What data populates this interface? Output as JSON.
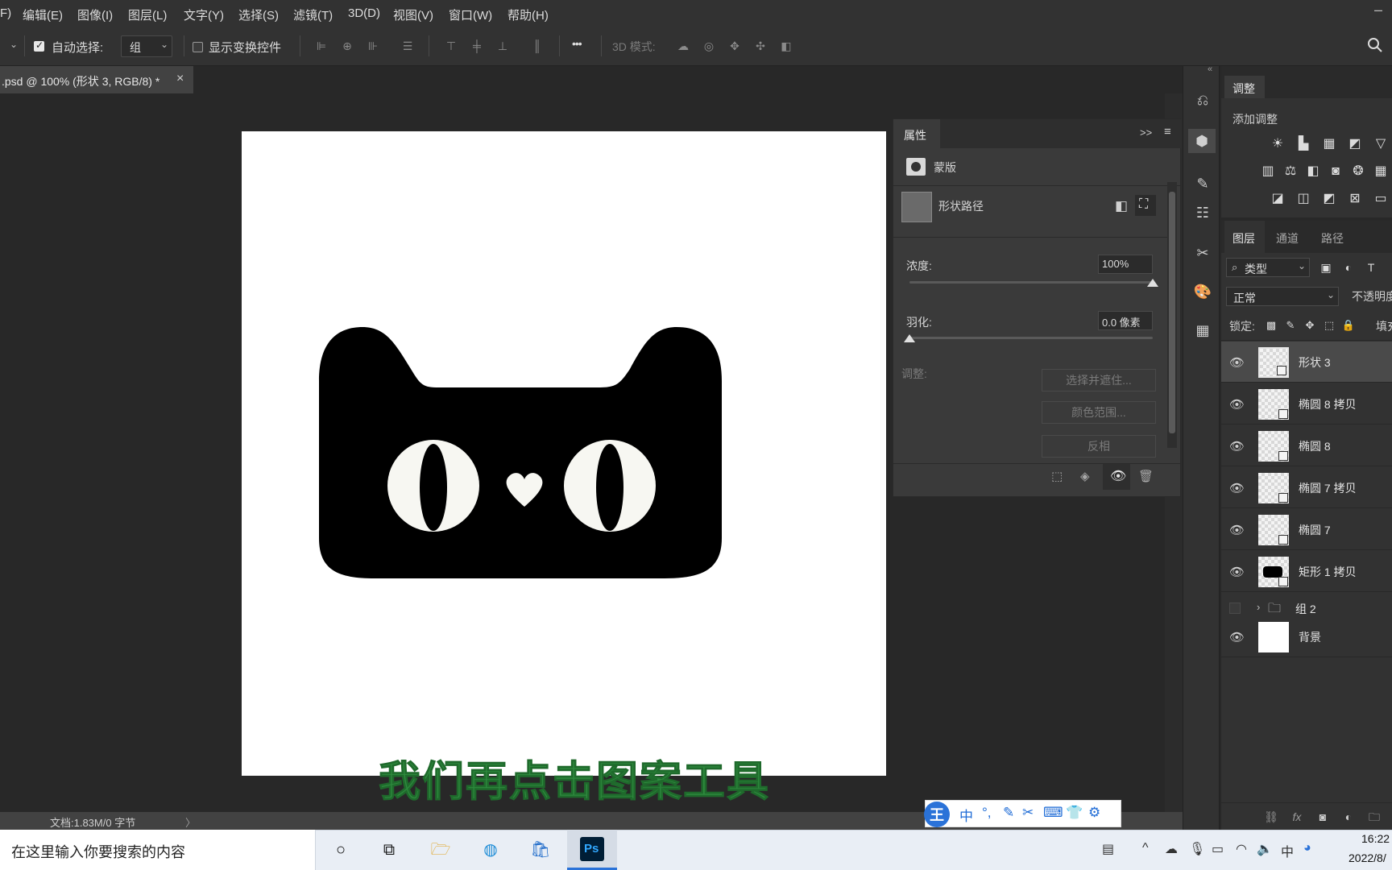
{
  "menu": {
    "items": [
      "F)",
      "编辑(E)",
      "图像(I)",
      "图层(L)",
      "文字(Y)",
      "选择(S)",
      "滤镜(T)",
      "3D(D)",
      "视图(V)",
      "窗口(W)",
      "帮助(H)"
    ],
    "minimize_glyph": "–"
  },
  "options": {
    "auto_select_label": "自动选择:",
    "auto_select_checked": true,
    "auto_select_value": "组",
    "show_transform_label": "显示变换控件",
    "show_transform_checked": false,
    "more_glyph": "•••",
    "mode_3d_label": "3D 模式:"
  },
  "document": {
    "tab_title": ".psd @ 100% (形状 3, RGB/8) *",
    "close_glyph": "×",
    "status_text": "文档:1.83M/0 字节",
    "status_arrow": "〉"
  },
  "subtitle": "我们再点击图案工具",
  "properties": {
    "tab": "属性",
    "expand_glyph": ">>",
    "menu_glyph": "≡",
    "mask_label": "蒙版",
    "shape_path_label": "形状路径",
    "density_label": "浓度:",
    "density_value": "100%",
    "density_level": 1.0,
    "feather_label": "羽化:",
    "feather_value": "0.0 像素",
    "feather_level": 0.0,
    "adjust_label": "调整:",
    "btn_select_mask": "选择并遮住...",
    "btn_color_range": "颜色范围...",
    "btn_invert": "反相"
  },
  "adjustments": {
    "tab": "调整",
    "add_label": "添加调整"
  },
  "layers_panel": {
    "tabs": [
      "图层",
      "通道",
      "路径"
    ],
    "filter_label": "类型",
    "blend_mode": "正常",
    "opacity_label": "不透明度",
    "lock_label": "锁定:",
    "fill_label": "填充"
  },
  "layers": [
    {
      "name": "形状 3",
      "selected": true,
      "visible": true
    },
    {
      "name": "椭圆 8 拷贝",
      "selected": false,
      "visible": true
    },
    {
      "name": "椭圆 8",
      "selected": false,
      "visible": true
    },
    {
      "name": "椭圆 7 拷贝",
      "selected": false,
      "visible": true
    },
    {
      "name": "椭圆 7",
      "selected": false,
      "visible": true
    },
    {
      "name": "矩形 1 拷贝",
      "selected": false,
      "visible": true
    },
    {
      "name": "组 2",
      "selected": false,
      "visible": false,
      "group": true
    },
    {
      "name": "背景",
      "selected": false,
      "visible": true,
      "background": true
    }
  ],
  "taskbar": {
    "search_placeholder": "在这里输入你要搜索的内容",
    "time": "16:22",
    "date": "2022/8/",
    "ime_char": "中",
    "ps_label": "Ps"
  },
  "ime": {
    "logo": "王",
    "lang": "中",
    "punct": "°,"
  },
  "colors": {
    "accent_green": "#2e8b3e",
    "ps_blue": "#31a8ff",
    "ps_dark": "#001e36"
  }
}
